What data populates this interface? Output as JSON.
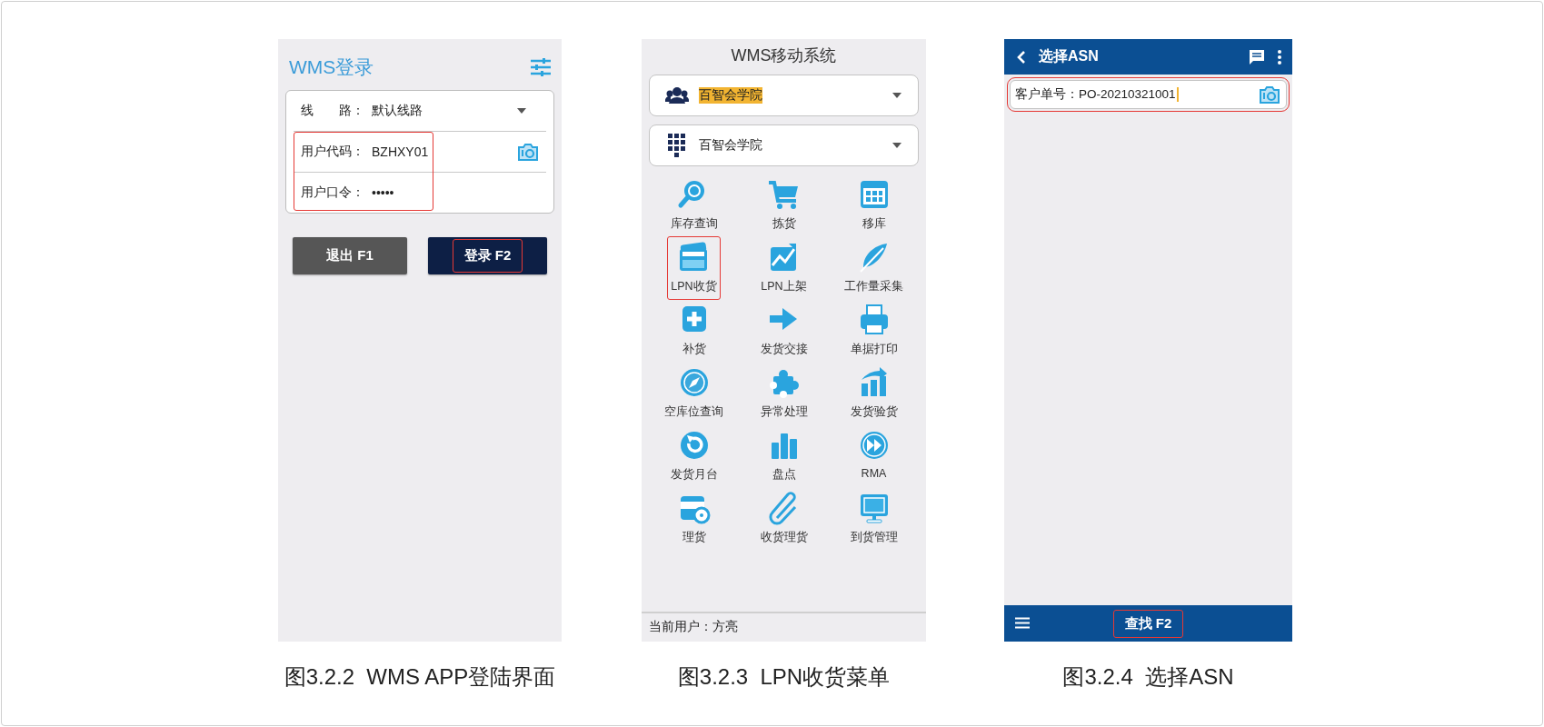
{
  "login_screen": {
    "title": "WMS登录",
    "fields": [
      {
        "label": "线　　路：",
        "value": "默认线路",
        "kind": "dropdown",
        "highlighted": false
      },
      {
        "label": "用户代码：",
        "value": "BZHXY01",
        "kind": "scan",
        "highlighted": true
      },
      {
        "label": "用户口令：",
        "value": "•••••",
        "kind": "password",
        "highlighted": true
      }
    ],
    "buttons": [
      {
        "label": "退出 F1",
        "kind": "secondary",
        "highlighted": false
      },
      {
        "label": "登录 F2",
        "kind": "primary",
        "highlighted": true
      }
    ],
    "caption": "图3.2.2  WMS APP登陆界面"
  },
  "menu_screen": {
    "title": "WMS移动系统",
    "selectors": [
      {
        "value": "百智会学院",
        "marked": true
      },
      {
        "value": "百智会学院",
        "marked": false
      }
    ],
    "items": [
      {
        "label": "库存查询",
        "highlighted": false
      },
      {
        "label": "拣货",
        "highlighted": false
      },
      {
        "label": "移库",
        "highlighted": false
      },
      {
        "label": "LPN收货",
        "highlighted": true
      },
      {
        "label": "LPN上架",
        "highlighted": false
      },
      {
        "label": "工作量采集",
        "highlighted": false
      },
      {
        "label": "补货",
        "highlighted": false
      },
      {
        "label": "发货交接",
        "highlighted": false
      },
      {
        "label": "单据打印",
        "highlighted": false
      },
      {
        "label": "空库位查询",
        "highlighted": false
      },
      {
        "label": "异常处理",
        "highlighted": false
      },
      {
        "label": "发货验货",
        "highlighted": false
      },
      {
        "label": "发货月台",
        "highlighted": false
      },
      {
        "label": "盘点",
        "highlighted": false
      },
      {
        "label": "RMA",
        "highlighted": false
      },
      {
        "label": "理货",
        "highlighted": false
      },
      {
        "label": "收货理货",
        "highlighted": false
      },
      {
        "label": "到货管理",
        "highlighted": false
      }
    ],
    "status": "当前用户：方亮",
    "caption": "图3.2.3  LPN收货菜单"
  },
  "asn_screen": {
    "title": "选择ASN",
    "field": {
      "label": "客户单号：",
      "value": "PO-20210321001",
      "highlighted": true
    },
    "button": {
      "label": "查找 F2",
      "highlighted": true
    },
    "caption": "图3.2.4  选择ASN"
  }
}
